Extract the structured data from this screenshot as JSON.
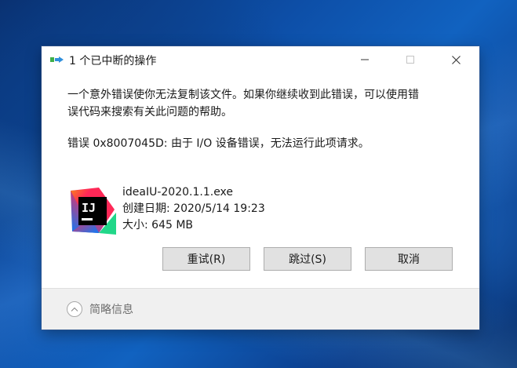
{
  "window": {
    "title": "1 个已中断的操作",
    "icon": "file-transfer-icon"
  },
  "message": {
    "main": "一个意外错误使你无法复制该文件。如果你继续收到此错误，可以使用错误代码来搜索有关此问题的帮助。",
    "main_line1": "一个意外错误使你无法复制该文件。如果你继续收到此错误，可以使用错",
    "main_line2": "误代码来搜索有关此问题的帮助。",
    "error": "错误 0x8007045D: 由于 I/O 设备错误，无法运行此项请求。"
  },
  "file": {
    "icon": "intellij-idea-icon",
    "name": "ideaIU-2020.1.1.exe",
    "created": "创建日期: 2020/5/14 19:23",
    "size": "大小: 645 MB"
  },
  "buttons": {
    "retry": "重试(R)",
    "skip": "跳过(S)",
    "cancel": "取消"
  },
  "footer": {
    "details": "简略信息"
  },
  "colors": {
    "desktop": "#0d4fa8",
    "dialog_bg": "#ffffff",
    "button_bg": "#e1e1e1",
    "footer_bg": "#f0f0f0"
  }
}
